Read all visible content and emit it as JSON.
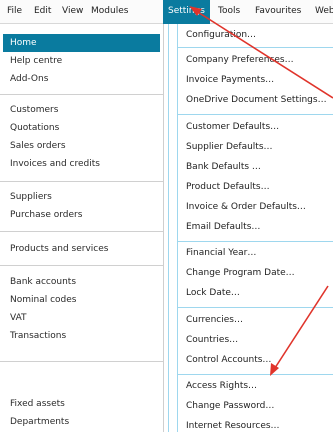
{
  "menubar": {
    "items": [
      "File",
      "Edit",
      "View",
      "Modules",
      "Settings",
      "Tools",
      "Favourites",
      "WebL"
    ],
    "active_index": 4
  },
  "sidebar": {
    "items": [
      "Home",
      "Help centre",
      "Add-Ons",
      "Customers",
      "Quotations",
      "Sales orders",
      "Invoices and credits",
      "Suppliers",
      "Purchase orders",
      "Products and services",
      "Bank accounts",
      "Nominal codes",
      "VAT",
      "Transactions",
      "Fixed assets",
      "Departments"
    ],
    "selected_index": 0
  },
  "settings_menu": {
    "items": [
      "Configuration…",
      "Company Preferences…",
      "Invoice Payments…",
      "OneDrive Document Settings…",
      "Customer Defaults…",
      "Supplier Defaults…",
      "Bank Defaults …",
      "Product Defaults…",
      "Invoice & Order Defaults…",
      "Email Defaults…",
      "Financial Year…",
      "Change Program Date…",
      "Lock Date…",
      "Currencies…",
      "Countries…",
      "Control Accounts…",
      "Access Rights…",
      "Change Password…",
      "Internet Resources…"
    ]
  },
  "colors": {
    "accent": "#0a7b9f",
    "menu_border": "#9ed7ee",
    "annotation_arrow": "#e0342b"
  }
}
